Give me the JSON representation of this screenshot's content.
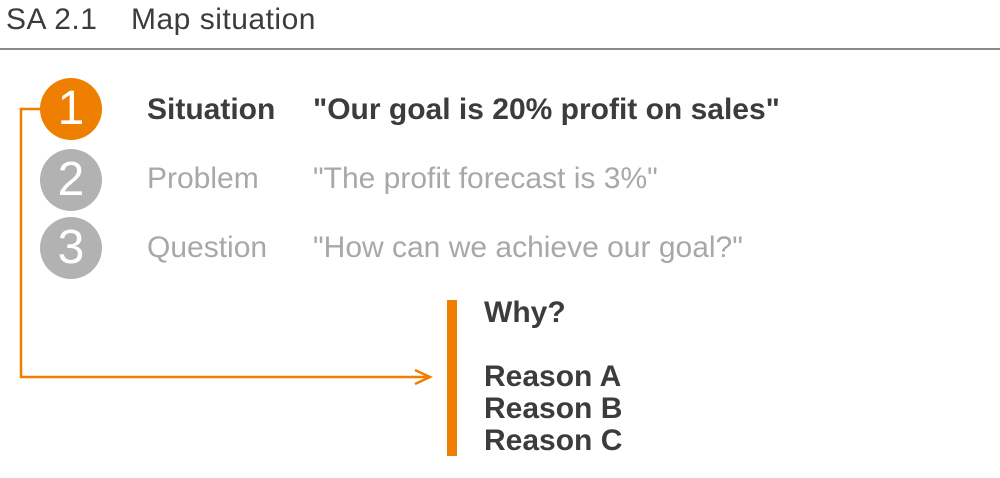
{
  "header": {
    "code": "SA 2.1",
    "title": "Map situation"
  },
  "steps": [
    {
      "number": "1",
      "label": "Situation",
      "quote": "\"Our goal is 20% profit on sales\"",
      "active": true
    },
    {
      "number": "2",
      "label": "Problem",
      "quote": "\"The profit forecast is 3%\"",
      "active": false
    },
    {
      "number": "3",
      "label": "Question",
      "quote": "\"How can we achieve our goal?\"",
      "active": false
    }
  ],
  "analysis": {
    "question": "Why?",
    "reasons": [
      "Reason A",
      "Reason B",
      "Reason C"
    ]
  },
  "colors": {
    "accent": "#ee7f00",
    "inactive": "#b2b2b2",
    "text": "#3c3c3c",
    "muted_text": "#a8a8a8"
  }
}
